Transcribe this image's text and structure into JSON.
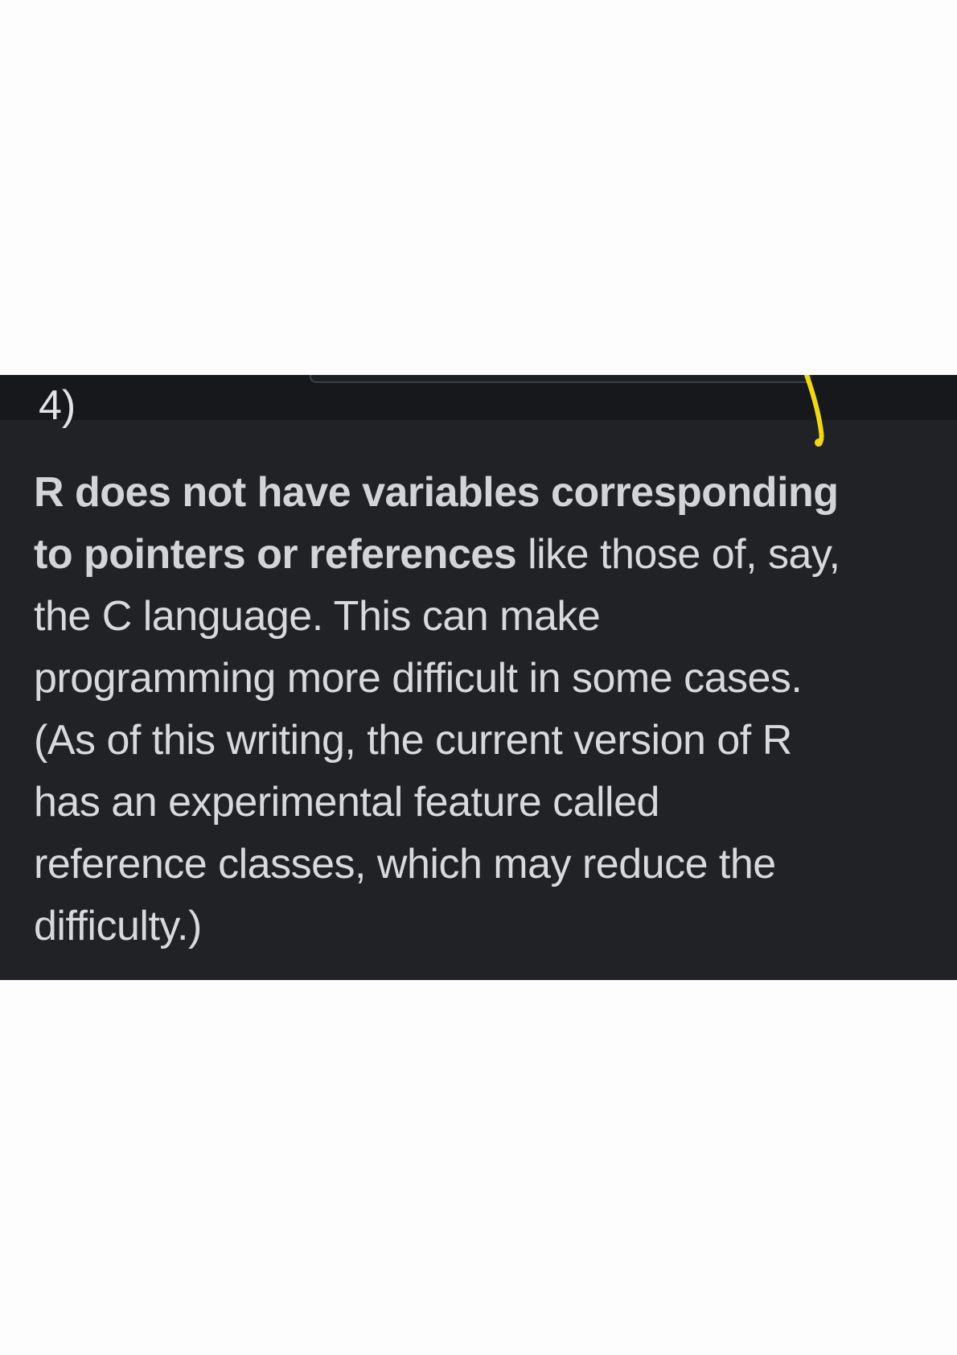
{
  "item": {
    "number": "4)"
  },
  "text": {
    "line1_bold": "R does not have variables corresponding",
    "line2_bold": "to pointers or references",
    "line2_rest": " like those of, say,",
    "line3": "the C language. This can make",
    "line4": "programming more difficult in some cases.",
    "line5": "(As of this writing, the current version of R",
    "line6": "has an experimental feature called",
    "line7": "reference classes, which may reduce the",
    "line8": "difficulty.)"
  },
  "colors": {
    "panel_background": "#202226",
    "text": "#d7d9dc",
    "highlighter_mark": "#f2d61b"
  }
}
